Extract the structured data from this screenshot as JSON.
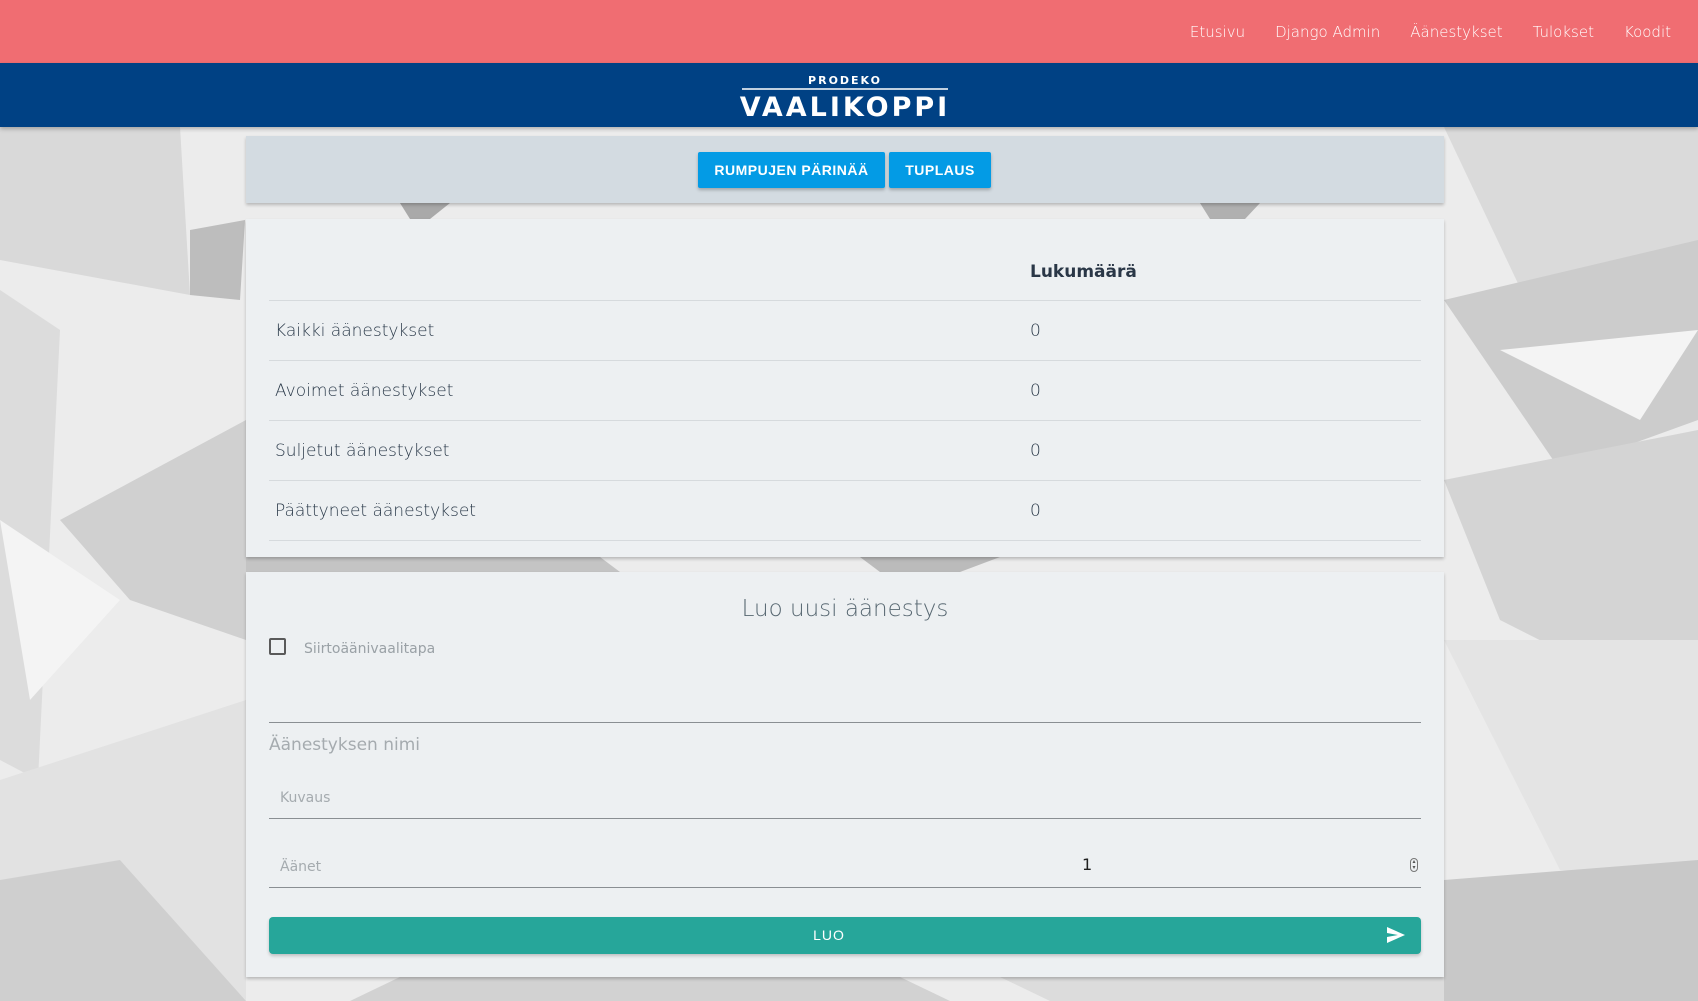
{
  "colors": {
    "topbar": "#f06d72",
    "brandbar": "#004184",
    "primary_button": "#039be5",
    "submit_button": "#26a69a"
  },
  "nav": {
    "items": [
      {
        "label": "Etusivu"
      },
      {
        "label": "Django Admin"
      },
      {
        "label": "Äänestykset"
      },
      {
        "label": "Tulokset"
      },
      {
        "label": "Koodit"
      }
    ]
  },
  "brand": {
    "small": "PRODEKO",
    "name": "VAALIKOPPI"
  },
  "toolbar": {
    "drumroll_label": "RUMPUJEN PÄRINÄÄ",
    "double_label": "TUPLAUS"
  },
  "stats": {
    "count_header": "Lukumäärä",
    "rows": [
      {
        "label": "Kaikki äänestykset",
        "count": "0"
      },
      {
        "label": "Avoimet äänestykset",
        "count": "0"
      },
      {
        "label": "Suljetut äänestykset",
        "count": "0"
      },
      {
        "label": "Päättyneet äänestykset",
        "count": "0"
      }
    ]
  },
  "create": {
    "title": "Luo uusi äänestys",
    "stv_label": "Siirtoäänivaalitapa",
    "stv_checked": false,
    "name_label": "Äänestyksen nimi",
    "description_label": "Kuvaus",
    "votes_label": "Äänet",
    "votes_value": "1",
    "submit_label": "LUO",
    "submit_icon": "send-icon"
  }
}
